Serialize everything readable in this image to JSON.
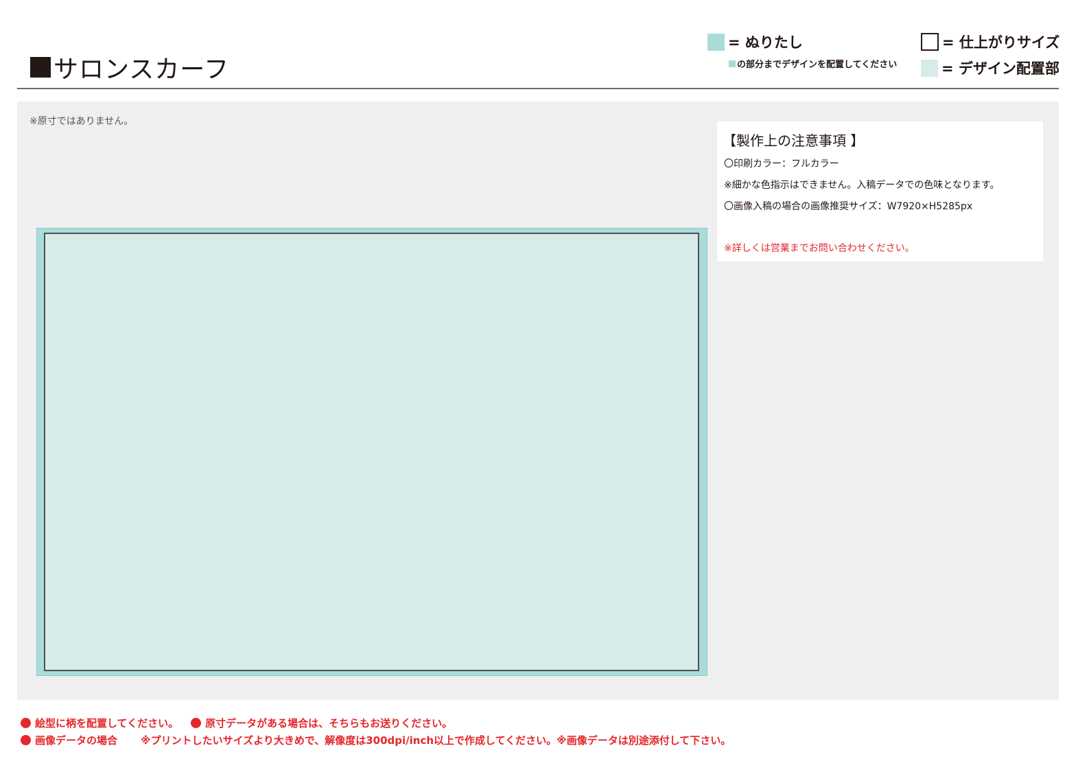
{
  "header": {
    "title": "サロンスカーフ"
  },
  "legend": {
    "bleed_label": "= ぬりたし",
    "bleed_note": "の部分までデザインを配置してください",
    "finish_label": "= 仕上がりサイズ",
    "design_label": "= デザイン配置部"
  },
  "canvas": {
    "not_actual_size": "※原寸ではありません。"
  },
  "notes": {
    "title": "【製作上の注意事項 】",
    "line1": "〇印刷カラー：フルカラー",
    "line2": "※細かな色指示はできません。入稿データでの色味となります。",
    "line3": "〇画像入稿の場合の画像推奨サイズ：W7920×H5285px",
    "contact": "※詳しくは営業までお問い合わせください。"
  },
  "footer": {
    "item1": "絵型に柄を配置してください。",
    "item2": "原寸データがある場合は、そちらもお送りください。",
    "item3_label": "画像データの場合",
    "item3_text": "※プリントしたいサイズより大きめで、解像度は300dpi/inch以上で作成してください。※画像データは別途添付して下さい。"
  },
  "colors": {
    "bleed": "#a9dcd9",
    "design_area": "#d7ecea",
    "panel": "#eeefee",
    "accent_red": "#e5262a",
    "text": "#231815"
  }
}
